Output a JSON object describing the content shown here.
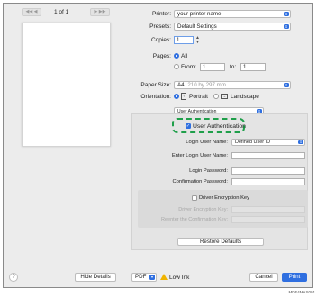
{
  "preview": {
    "nav_first": "◀◀ ◀",
    "page_indicator": "1 of 1",
    "nav_last": "▶ ▶▶"
  },
  "printer": {
    "label": "Printer:",
    "value": "your printer name"
  },
  "presets": {
    "label": "Presets:",
    "value": "Default Settings"
  },
  "copies": {
    "label": "Copies:",
    "value": "1"
  },
  "pages": {
    "label": "Pages:",
    "all_label": "All",
    "from_label": "From:",
    "from_value": "1",
    "to_label": "to:",
    "to_value": "1"
  },
  "paper_size": {
    "label": "Paper Size:",
    "value": "A4",
    "dimensions": "210 by 297 mm"
  },
  "orientation": {
    "label": "Orientation:",
    "portrait": "Portrait",
    "landscape": "Landscape"
  },
  "section_popup": {
    "value": "User Authentication"
  },
  "auth": {
    "checkbox_label": "User Authentication",
    "login_user_name_label": "Login User Name:",
    "login_user_name_value": "Defined User ID",
    "enter_login_user_name_label": "Enter Login User Name:",
    "login_password_label": "Login Password:",
    "confirmation_password_label": "Confirmation Password:",
    "driver_encryption_key_label": "Driver Encryption Key",
    "driver_encryption_key_field_label": "Driver Encryption Key:",
    "reenter_confirmation_key_label": "Reenter the Confirmation Key:",
    "restore_defaults": "Restore Defaults"
  },
  "footer": {
    "help": "?",
    "hide_details": "Hide Details",
    "pdf": "PDF",
    "low_ink": "Low Ink",
    "cancel": "Cancel",
    "print": "Print"
  },
  "figure_code": "MDF4MAS001",
  "colors": {
    "accent": "#2f6fe0",
    "highlight": "#1f9f4a",
    "warning": "#f0b400"
  }
}
